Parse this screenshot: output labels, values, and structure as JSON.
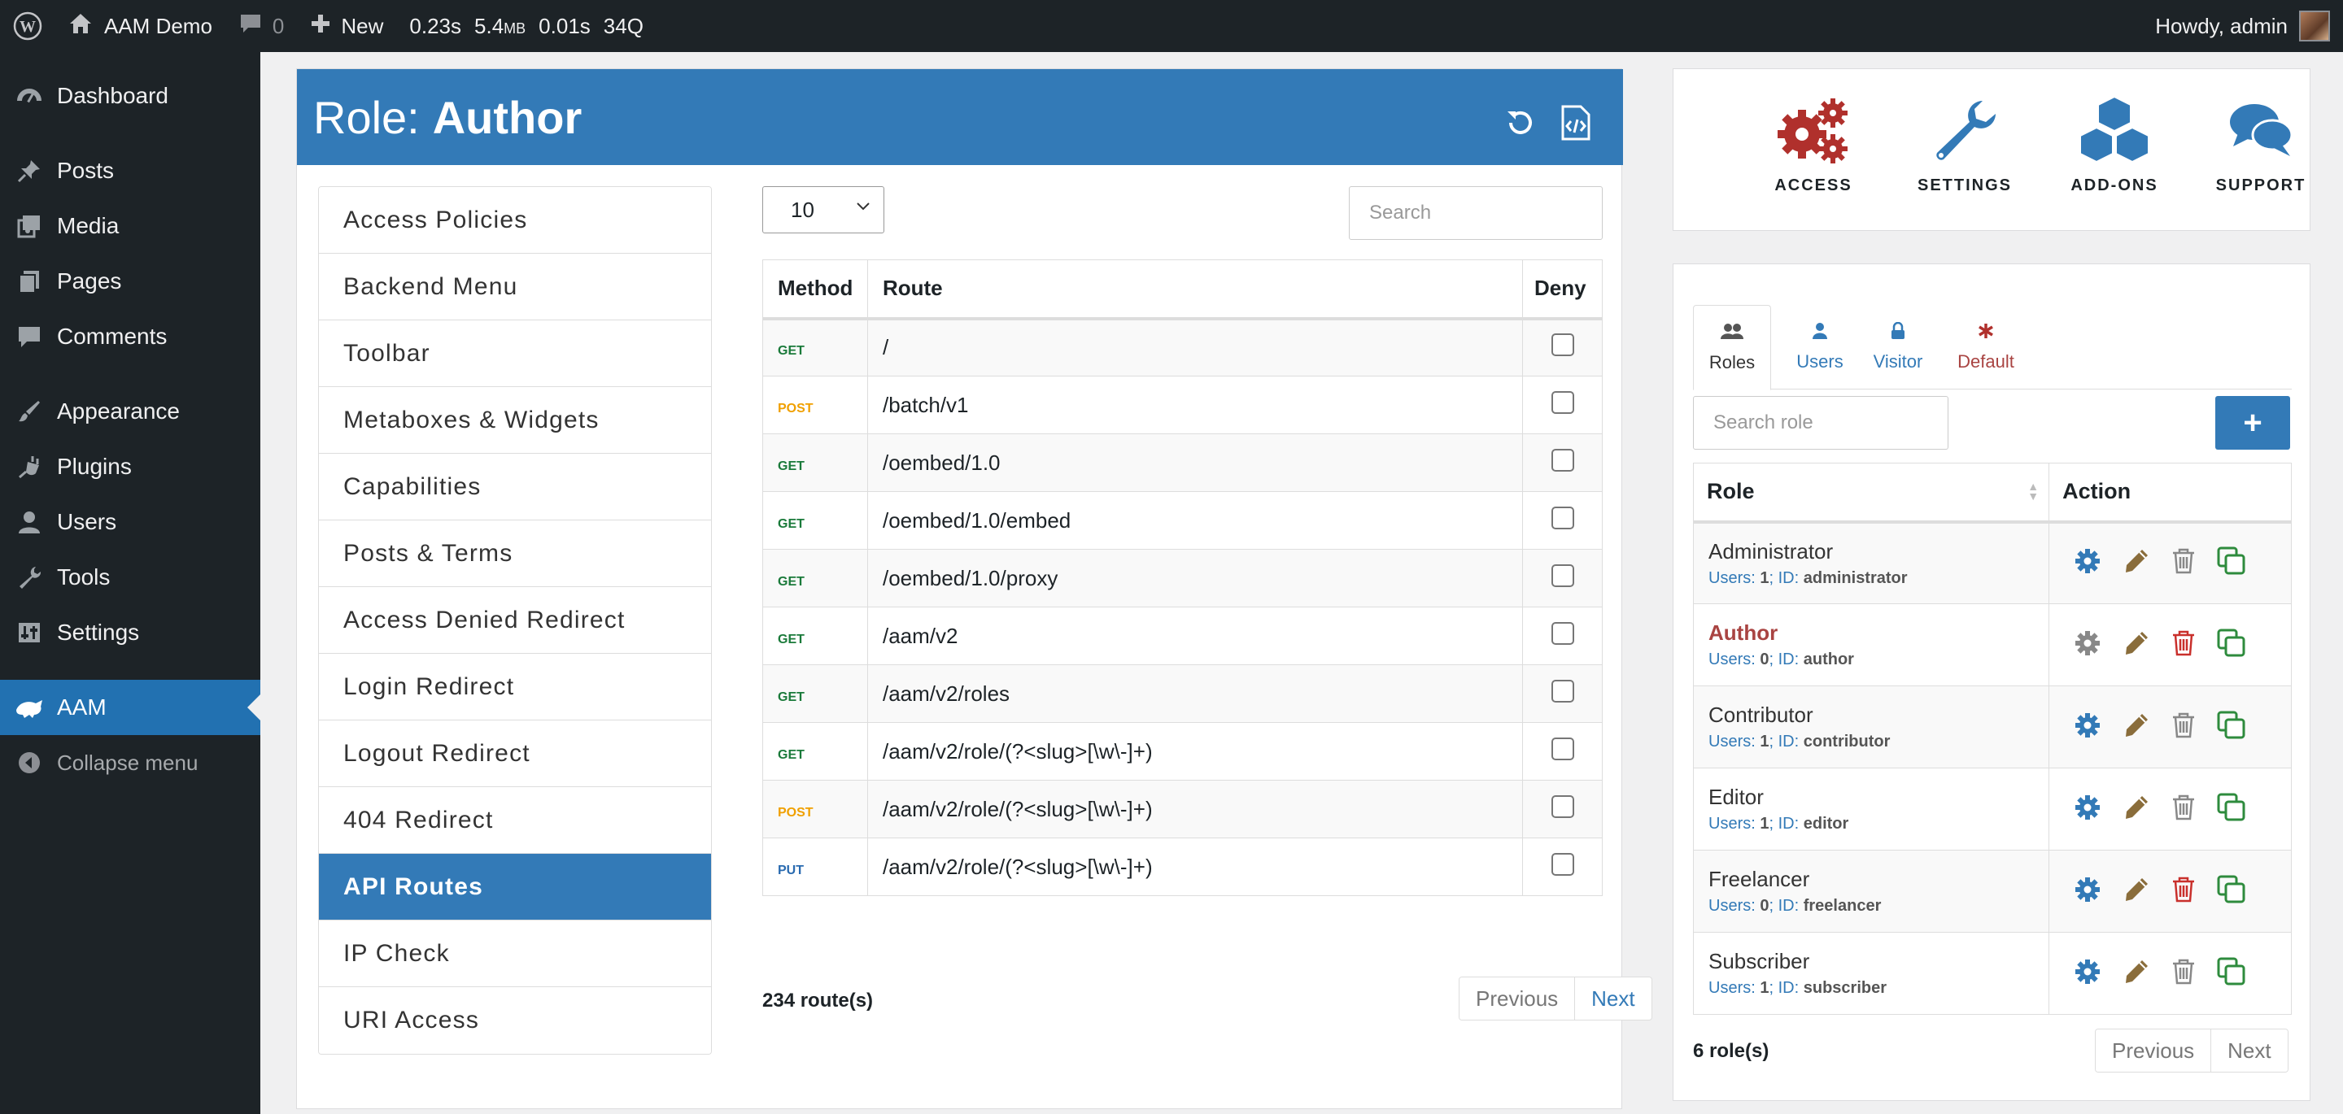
{
  "adminbar": {
    "site_name": "AAM Demo",
    "comments_count": "0",
    "new_label": "New",
    "query_monitor": {
      "time": "0.23s",
      "memory": "5.4",
      "memory_unit": "MB",
      "db_time": "0.01s",
      "queries": "34Q"
    },
    "greeting": "Howdy, admin"
  },
  "sidebar": {
    "items": [
      {
        "label": "Dashboard",
        "icon": "dashboard-icon"
      },
      {
        "label": "Posts",
        "icon": "pin-icon"
      },
      {
        "label": "Media",
        "icon": "media-icon"
      },
      {
        "label": "Pages",
        "icon": "pages-icon"
      },
      {
        "label": "Comments",
        "icon": "comments-icon"
      },
      {
        "label": "Appearance",
        "icon": "brush-icon"
      },
      {
        "label": "Plugins",
        "icon": "plugin-icon"
      },
      {
        "label": "Users",
        "icon": "user-icon"
      },
      {
        "label": "Tools",
        "icon": "wrench-icon"
      },
      {
        "label": "Settings",
        "icon": "settings-sliders-icon"
      },
      {
        "label": "AAM",
        "icon": "aam-icon"
      }
    ],
    "collapse_label": "Collapse menu"
  },
  "header": {
    "prefix": "Role:",
    "role": "Author"
  },
  "features": [
    "Access Policies",
    "Backend Menu",
    "Toolbar",
    "Metaboxes & Widgets",
    "Capabilities",
    "Posts & Terms",
    "Access Denied Redirect",
    "Login Redirect",
    "Logout Redirect",
    "404 Redirect",
    "API Routes",
    "IP Check",
    "URI Access"
  ],
  "routes": {
    "page_size": "10",
    "search_placeholder": "Search",
    "headers": {
      "method": "Method",
      "route": "Route",
      "deny": "Deny"
    },
    "rows": [
      {
        "method": "GET",
        "route": "/"
      },
      {
        "method": "POST",
        "route": "/batch/v1"
      },
      {
        "method": "GET",
        "route": "/oembed/1.0"
      },
      {
        "method": "GET",
        "route": "/oembed/1.0/embed"
      },
      {
        "method": "GET",
        "route": "/oembed/1.0/proxy"
      },
      {
        "method": "GET",
        "route": "/aam/v2"
      },
      {
        "method": "GET",
        "route": "/aam/v2/roles"
      },
      {
        "method": "GET",
        "route": "/aam/v2/role/(?<slug>[\\w\\-]+)"
      },
      {
        "method": "POST",
        "route": "/aam/v2/role/(?<slug>[\\w\\-]+)"
      },
      {
        "method": "PUT",
        "route": "/aam/v2/role/(?<slug>[\\w\\-]+)"
      }
    ],
    "count": "234 route(s)",
    "prev": "Previous",
    "next": "Next"
  },
  "topnav": {
    "access": "ACCESS",
    "settings": "SETTINGS",
    "addons": "ADD-ONS",
    "support": "SUPPORT"
  },
  "subjects": {
    "tabs": {
      "roles": "Roles",
      "users": "Users",
      "visitor": "Visitor",
      "default": "Default"
    },
    "search_placeholder": "Search role",
    "add_label": "+",
    "headers": {
      "role": "Role",
      "action": "Action"
    },
    "users_label": "Users:",
    "id_label": "ID:",
    "rows": [
      {
        "name": "Administrator",
        "users": "1",
        "id": "administrator"
      },
      {
        "name": "Author",
        "users": "0",
        "id": "author"
      },
      {
        "name": "Contributor",
        "users": "1",
        "id": "contributor"
      },
      {
        "name": "Editor",
        "users": "1",
        "id": "editor"
      },
      {
        "name": "Freelancer",
        "users": "0",
        "id": "freelancer"
      },
      {
        "name": "Subscriber",
        "users": "1",
        "id": "subscriber"
      }
    ],
    "count": "6 role(s)",
    "prev": "Previous",
    "next": "Next"
  },
  "colors": {
    "primary": "#337ab7",
    "wp_blue": "#2271b1",
    "danger": "#a94442",
    "success": "#2e8b3d",
    "edit": "#8a6d3b"
  }
}
